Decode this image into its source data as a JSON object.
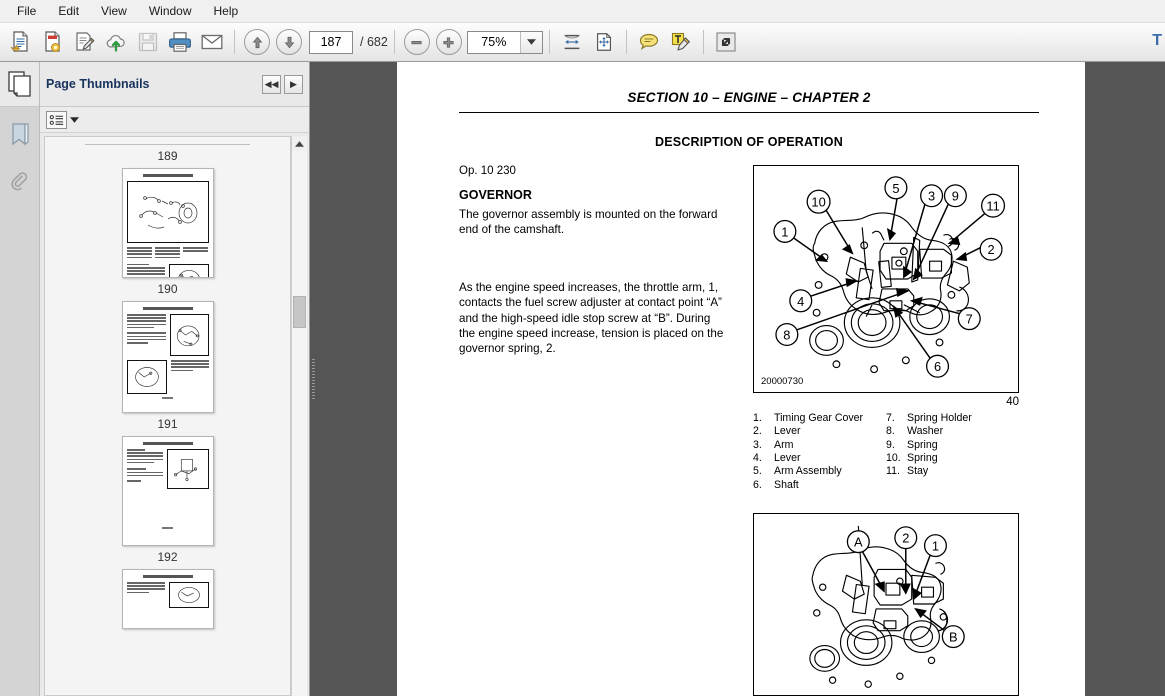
{
  "menubar": {
    "items": [
      "File",
      "Edit",
      "View",
      "Window",
      "Help"
    ]
  },
  "toolbar": {
    "buttons": [
      {
        "name": "open-document-icon",
        "title": "Open"
      },
      {
        "name": "create-pdf-icon",
        "title": "Create PDF"
      },
      {
        "name": "edit-document-icon",
        "title": "Edit"
      },
      {
        "name": "cloud-upload-icon",
        "title": "Upload"
      },
      {
        "name": "save-icon",
        "title": "Save"
      },
      {
        "name": "print-icon",
        "title": "Print"
      },
      {
        "name": "email-icon",
        "title": "Email"
      }
    ],
    "prev_page_label": "previous-page",
    "next_page_label": "next-page",
    "page_number": "187",
    "page_total": "/ 682",
    "zoom_out_label": "zoom-out",
    "zoom_in_label": "zoom-in",
    "zoom_value": "75%",
    "fit_width_label": "fit-width",
    "fit_page_label": "fit-page",
    "comment_label": "add-comment",
    "highlight_label": "highlight-text",
    "fullscreen_label": "fullscreen",
    "right_label": "T"
  },
  "sidebar": {
    "panel_title": "Page Thumbnails",
    "collapse_label": "◀◀",
    "expand_label": "▶",
    "options_label": "thumbnail-options",
    "rail_icons": [
      "pages-icon",
      "bookmark-icon",
      "attachment-icon"
    ],
    "thumbnails": [
      {
        "label": "189"
      },
      {
        "label": "190"
      },
      {
        "label": "191"
      },
      {
        "label": "192"
      }
    ]
  },
  "document": {
    "header": "SECTION 10 – ENGINE – CHAPTER 2",
    "subheader": "DESCRIPTION OF OPERATION",
    "op_number": "Op. 10 230",
    "section_title": "GOVERNOR",
    "intro_paragraph": "The governor assembly is mounted on the forward end of the camshaft.",
    "second_paragraph": "As the engine speed increases, the throttle arm, 1, contacts the fuel screw adjuster at contact point “A” and the high-speed idle stop screw at “B”. During the engine speed increase, tension is placed on the governor spring, 2.",
    "figure1": {
      "reference": "20000730",
      "number": "40",
      "callouts": [
        "1",
        "2",
        "3",
        "4",
        "5",
        "6",
        "7",
        "8",
        "9",
        "10",
        "11"
      ]
    },
    "figure2": {
      "callouts": [
        "A",
        "B",
        "1",
        "2"
      ]
    },
    "legend": {
      "left": [
        {
          "index": "1.",
          "label": "Timing Gear Cover"
        },
        {
          "index": "2.",
          "label": "Lever"
        },
        {
          "index": "3.",
          "label": "Arm"
        },
        {
          "index": "4.",
          "label": "Lever"
        },
        {
          "index": "5.",
          "label": "Arm Assembly"
        },
        {
          "index": "6.",
          "label": "Shaft"
        }
      ],
      "right": [
        {
          "index": "7.",
          "label": "Spring Holder"
        },
        {
          "index": "8.",
          "label": "Washer"
        },
        {
          "index": "9.",
          "label": "Spring"
        },
        {
          "index": "10.",
          "label": "Spring"
        },
        {
          "index": "11.",
          "label": "Stay"
        }
      ]
    }
  }
}
